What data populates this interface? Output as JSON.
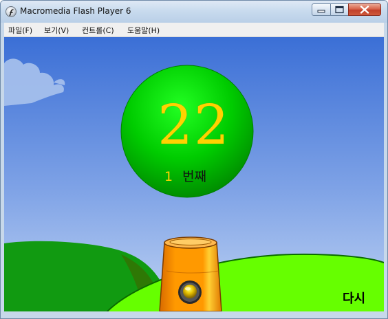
{
  "window": {
    "title": "Macromedia Flash Player 6",
    "controls": {
      "minimize": "minimize-icon",
      "maximize": "maximize-icon",
      "close": "close-icon"
    }
  },
  "menu": [
    {
      "label": "파일(F)"
    },
    {
      "label": "보기(V)"
    },
    {
      "label": "컨트롤(C)"
    },
    {
      "label": "도움말(H)"
    }
  ],
  "game": {
    "ball_number": "22",
    "turn_number": "1",
    "turn_label": "번째",
    "retry_label": "다시",
    "colors": {
      "sky_top": "#3b6fd6",
      "sky_bottom": "#bfd3f3",
      "ball": "#00cc00",
      "number": "#ffd200",
      "hill_light": "#66ff00",
      "hill_dark": "#119a11",
      "cannon": "#ff9900"
    },
    "icons": {
      "app": "flash-icon",
      "fire": "fire-button-icon"
    }
  }
}
